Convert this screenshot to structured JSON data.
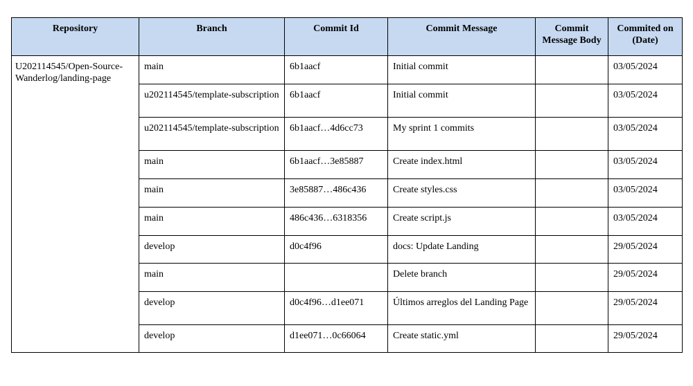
{
  "table": {
    "headers": [
      "Repository",
      "Branch",
      "Commit Id",
      "Commit Message",
      "Commit Message Body",
      "Commited on (Date)"
    ],
    "repository": "U202114545/Open-Source-Wanderlog/landing-page",
    "rows": [
      {
        "branch": "main",
        "commit_id": "6b1aacf",
        "message": "Initial commit",
        "body": "",
        "date": "03/05/2024"
      },
      {
        "branch": "u202114545/template-subscription",
        "commit_id": "6b1aacf",
        "message": "Initial commit",
        "body": "",
        "date": "03/05/2024"
      },
      {
        "branch": "u202114545/template-subscription",
        "commit_id": "6b1aacf…4d6cc73",
        "message": "My sprint 1 commits",
        "body": "",
        "date": "03/05/2024"
      },
      {
        "branch": "main",
        "commit_id": "6b1aacf…3e85887",
        "message": "Create index.html",
        "body": "",
        "date": "03/05/2024"
      },
      {
        "branch": "main",
        "commit_id": "3e85887…486c436",
        "message": "Create styles.css",
        "body": "",
        "date": "03/05/2024"
      },
      {
        "branch": "main",
        "commit_id": "486c436…6318356",
        "message": "Create script.js",
        "body": "",
        "date": "03/05/2024"
      },
      {
        "branch": "develop",
        "commit_id": "d0c4f96",
        "message": "docs: Update Landing",
        "body": "",
        "date": "29/05/2024"
      },
      {
        "branch": "main",
        "commit_id": "",
        "message": "Delete branch",
        "body": "",
        "date": "29/05/2024"
      },
      {
        "branch": "develop",
        "commit_id": "d0c4f96…d1ee071",
        "message": "Últimos arreglos del Landing Page",
        "body": "",
        "date": "29/05/2024"
      },
      {
        "branch": "develop",
        "commit_id": "d1ee071…0c66064",
        "message": "Create static.yml",
        "body": "",
        "date": "29/05/2024"
      }
    ]
  }
}
